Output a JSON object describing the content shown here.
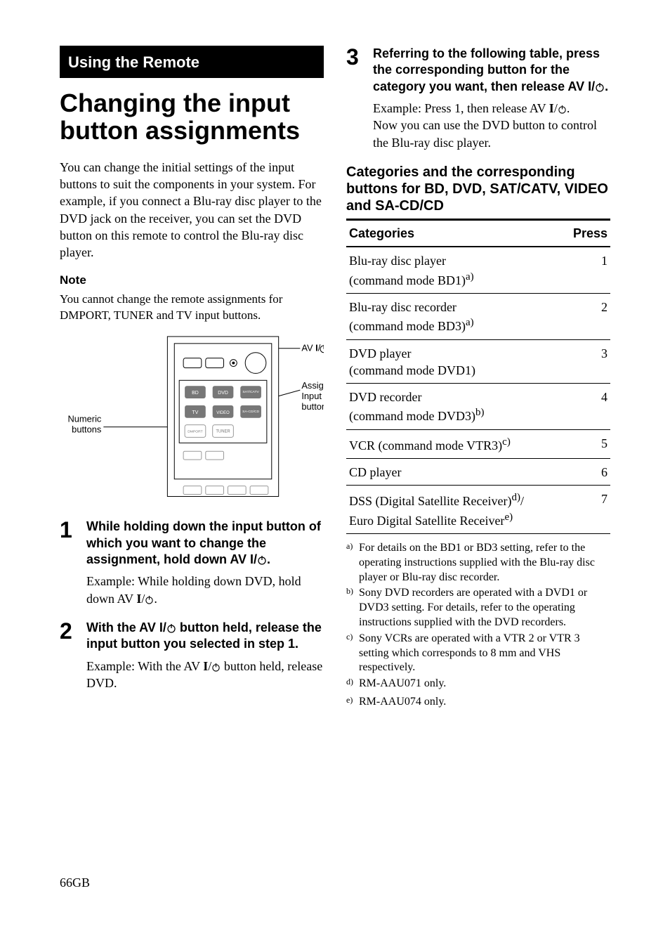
{
  "page": {
    "number": "66",
    "suffix": "GB"
  },
  "left": {
    "section_header": "Using the Remote",
    "title": "Changing the input button assignments",
    "intro": "You can change the initial settings of the input buttons to suit the components in your system. For example, if you connect a Blu-ray disc player to the DVD jack on the receiver, you can set the DVD button on this remote to control the Blu-ray disc player.",
    "note_heading": "Note",
    "note_text": "You cannot change the remote assignments for DMPORT, TUNER and TV input buttons.",
    "diagram": {
      "label_left": "Numeric buttons",
      "label_top_right_prefix": "AV ",
      "label_top_right_mid": "I",
      "label_right": "Assignable Input buttons",
      "buttons": {
        "bd": "BD",
        "dvd": "DVD",
        "sat": "SAT/CATV",
        "tv": "TV",
        "video": "VIDEO",
        "sacd": "SA-CD/CD",
        "dmport": "DMPORT",
        "tuner": "TUNER"
      }
    },
    "step1": {
      "num": "1",
      "head_a": "While holding down the input button of which you want to change the assignment, hold down AV ",
      "head_b": "I",
      "head_c": "/",
      "head_d": ".",
      "ex_a": "Example: While holding down DVD, hold down AV ",
      "ex_b": "I",
      "ex_c": "/",
      "ex_d": "."
    },
    "step2": {
      "num": "2",
      "head_a": "With the AV ",
      "head_b": "I",
      "head_c": "/",
      "head_d": " button held, release the input button you selected in step 1.",
      "ex_a": "Example: With the AV ",
      "ex_b": "I",
      "ex_c": "/",
      "ex_d": " button held, release DVD."
    }
  },
  "right": {
    "step3": {
      "num": "3",
      "head_a": "Referring to the following table, press the corresponding button for the category you want, then release AV ",
      "head_b": "I",
      "head_c": "/",
      "head_d": ".",
      "ex_a": "Example: Press 1, then release AV ",
      "ex_b": "I",
      "ex_c": "/",
      "ex_d": ".",
      "ex2": "Now you can use the DVD button to control the Blu-ray disc player."
    },
    "subheading": "Categories and the corresponding buttons for BD, DVD, SAT/CATV, VIDEO and SA-CD/CD",
    "table": {
      "h1": "Categories",
      "h2": "Press",
      "rows": [
        {
          "cat_a": "Blu-ray disc player",
          "cat_b": "(command mode BD1)",
          "sup": "a)",
          "press": "1"
        },
        {
          "cat_a": "Blu-ray disc recorder",
          "cat_b": "(command mode BD3)",
          "sup": "a)",
          "press": "2"
        },
        {
          "cat_a": "DVD player",
          "cat_b": "(command mode DVD1)",
          "sup": "",
          "press": "3"
        },
        {
          "cat_a": "DVD recorder",
          "cat_b": "(command mode DVD3)",
          "sup": "b)",
          "press": "4"
        },
        {
          "cat_a": "VCR (command mode VTR3)",
          "cat_b": "",
          "sup": "c)",
          "press": "5"
        },
        {
          "cat_a": "CD player",
          "cat_b": "",
          "sup": "",
          "press": "6"
        },
        {
          "cat_a": "DSS (Digital Satellite Receiver)",
          "cat_sup1": "d)",
          "cat_mid": "/",
          "cat_c": "Euro Digital Satellite Receiver",
          "cat_sup2": "e)",
          "press": "7"
        }
      ]
    },
    "footnotes": {
      "a": {
        "mark": "a)",
        "text": "For details on the BD1 or BD3 setting, refer to the operating instructions supplied with the Blu-ray disc player or Blu-ray disc recorder."
      },
      "b": {
        "mark": "b)",
        "text": "Sony DVD recorders are operated with a DVD1 or DVD3 setting. For details, refer to the operating instructions supplied with the DVD recorders."
      },
      "c": {
        "mark": "c)",
        "text": "Sony VCRs are operated with a VTR 2 or VTR 3 setting which corresponds to 8 mm and VHS respectively."
      },
      "d": {
        "mark": "d)",
        "text": "RM-AAU071 only."
      },
      "e": {
        "mark": "e)",
        "text": "RM-AAU074 only."
      }
    }
  }
}
